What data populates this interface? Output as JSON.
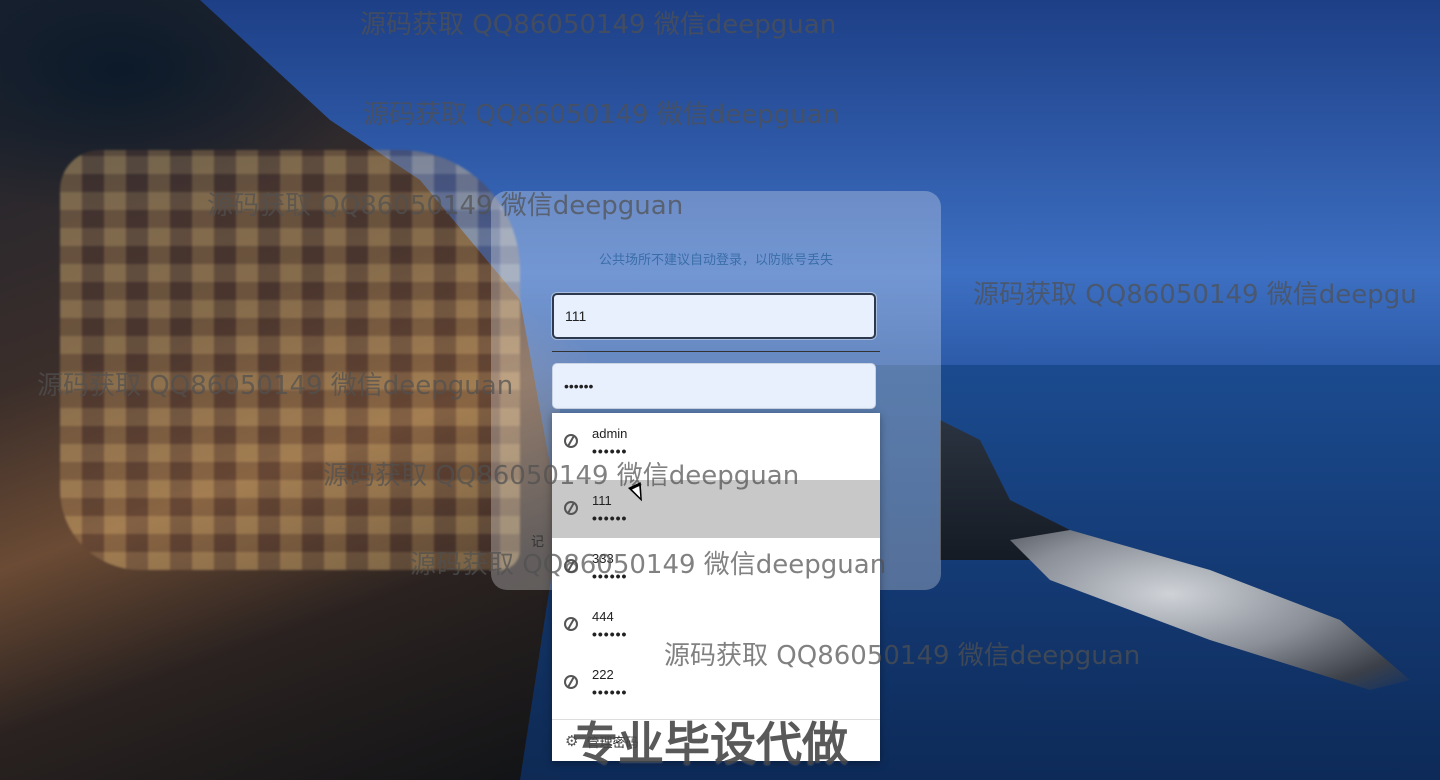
{
  "login": {
    "tip": "公共场所不建议自动登录，以防账号丢失",
    "username_value": "111",
    "password_value": "••••••",
    "remember_label": "记"
  },
  "autofill": {
    "items": [
      {
        "username": "admin",
        "password": "••••••"
      },
      {
        "username": "111",
        "password": "••••••"
      },
      {
        "username": "333",
        "password": "••••••"
      },
      {
        "username": "444",
        "password": "••••••"
      },
      {
        "username": "222",
        "password": "••••••"
      }
    ],
    "hovered_index": 1,
    "manage_label": "管理密码"
  },
  "watermarks": [
    "源码获取 QQ86050149 微信deepguan",
    "源码获取 QQ86050149 微信deepguan",
    "源码获取 QQ86050149 微信deepguan",
    "源码获取 QQ86050149 微信deepgu",
    "源码获取 QQ86050149 微信deepguan",
    "源码获取 QQ86050149 微信deepguan",
    "源码获取 QQ86050149 微信deepguan",
    "源码获取 QQ86050149 微信deepguan"
  ],
  "promo": "专业毕设代做",
  "icons": {
    "password_entry": "key-icon",
    "manage": "gear-icon"
  }
}
